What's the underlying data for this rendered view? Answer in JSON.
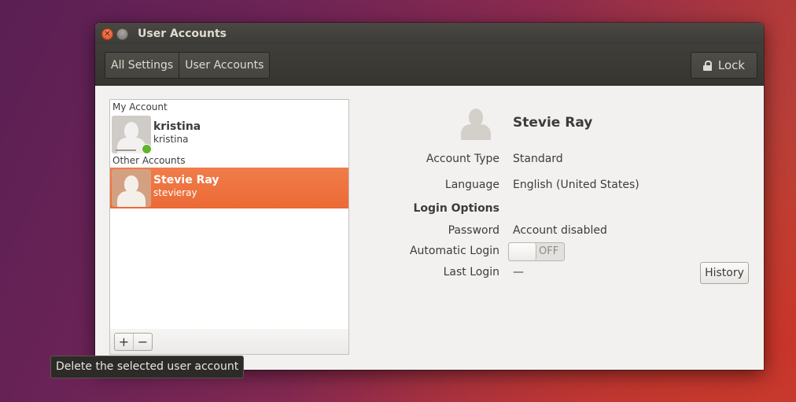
{
  "window": {
    "title": "User Accounts"
  },
  "toolbar": {
    "breadcrumbs": [
      "All Settings",
      "User Accounts"
    ],
    "lock_label": "Lock"
  },
  "accounts": {
    "my_account_label": "My Account",
    "other_accounts_label": "Other Accounts",
    "me": {
      "name": "kristina",
      "username": "kristina",
      "online": true
    },
    "others": [
      {
        "name": "Stevie Ray",
        "username": "stevieray",
        "selected": true
      }
    ],
    "add_label": "+",
    "remove_label": "−",
    "tooltip": "Delete the selected user account"
  },
  "details": {
    "full_name": "Stevie Ray",
    "account_type_label": "Account Type",
    "account_type_value": "Standard",
    "language_label": "Language",
    "language_value": "English (United States)",
    "login_options_label": "Login Options",
    "password_label": "Password",
    "password_value": "Account disabled",
    "auto_login_label": "Automatic Login",
    "auto_login_state": "OFF",
    "last_login_label": "Last Login",
    "last_login_value": "—",
    "history_label": "History"
  },
  "colors": {
    "selection": "#ef7442",
    "online": "#62b42a",
    "titlebar": "#3c3b37"
  }
}
